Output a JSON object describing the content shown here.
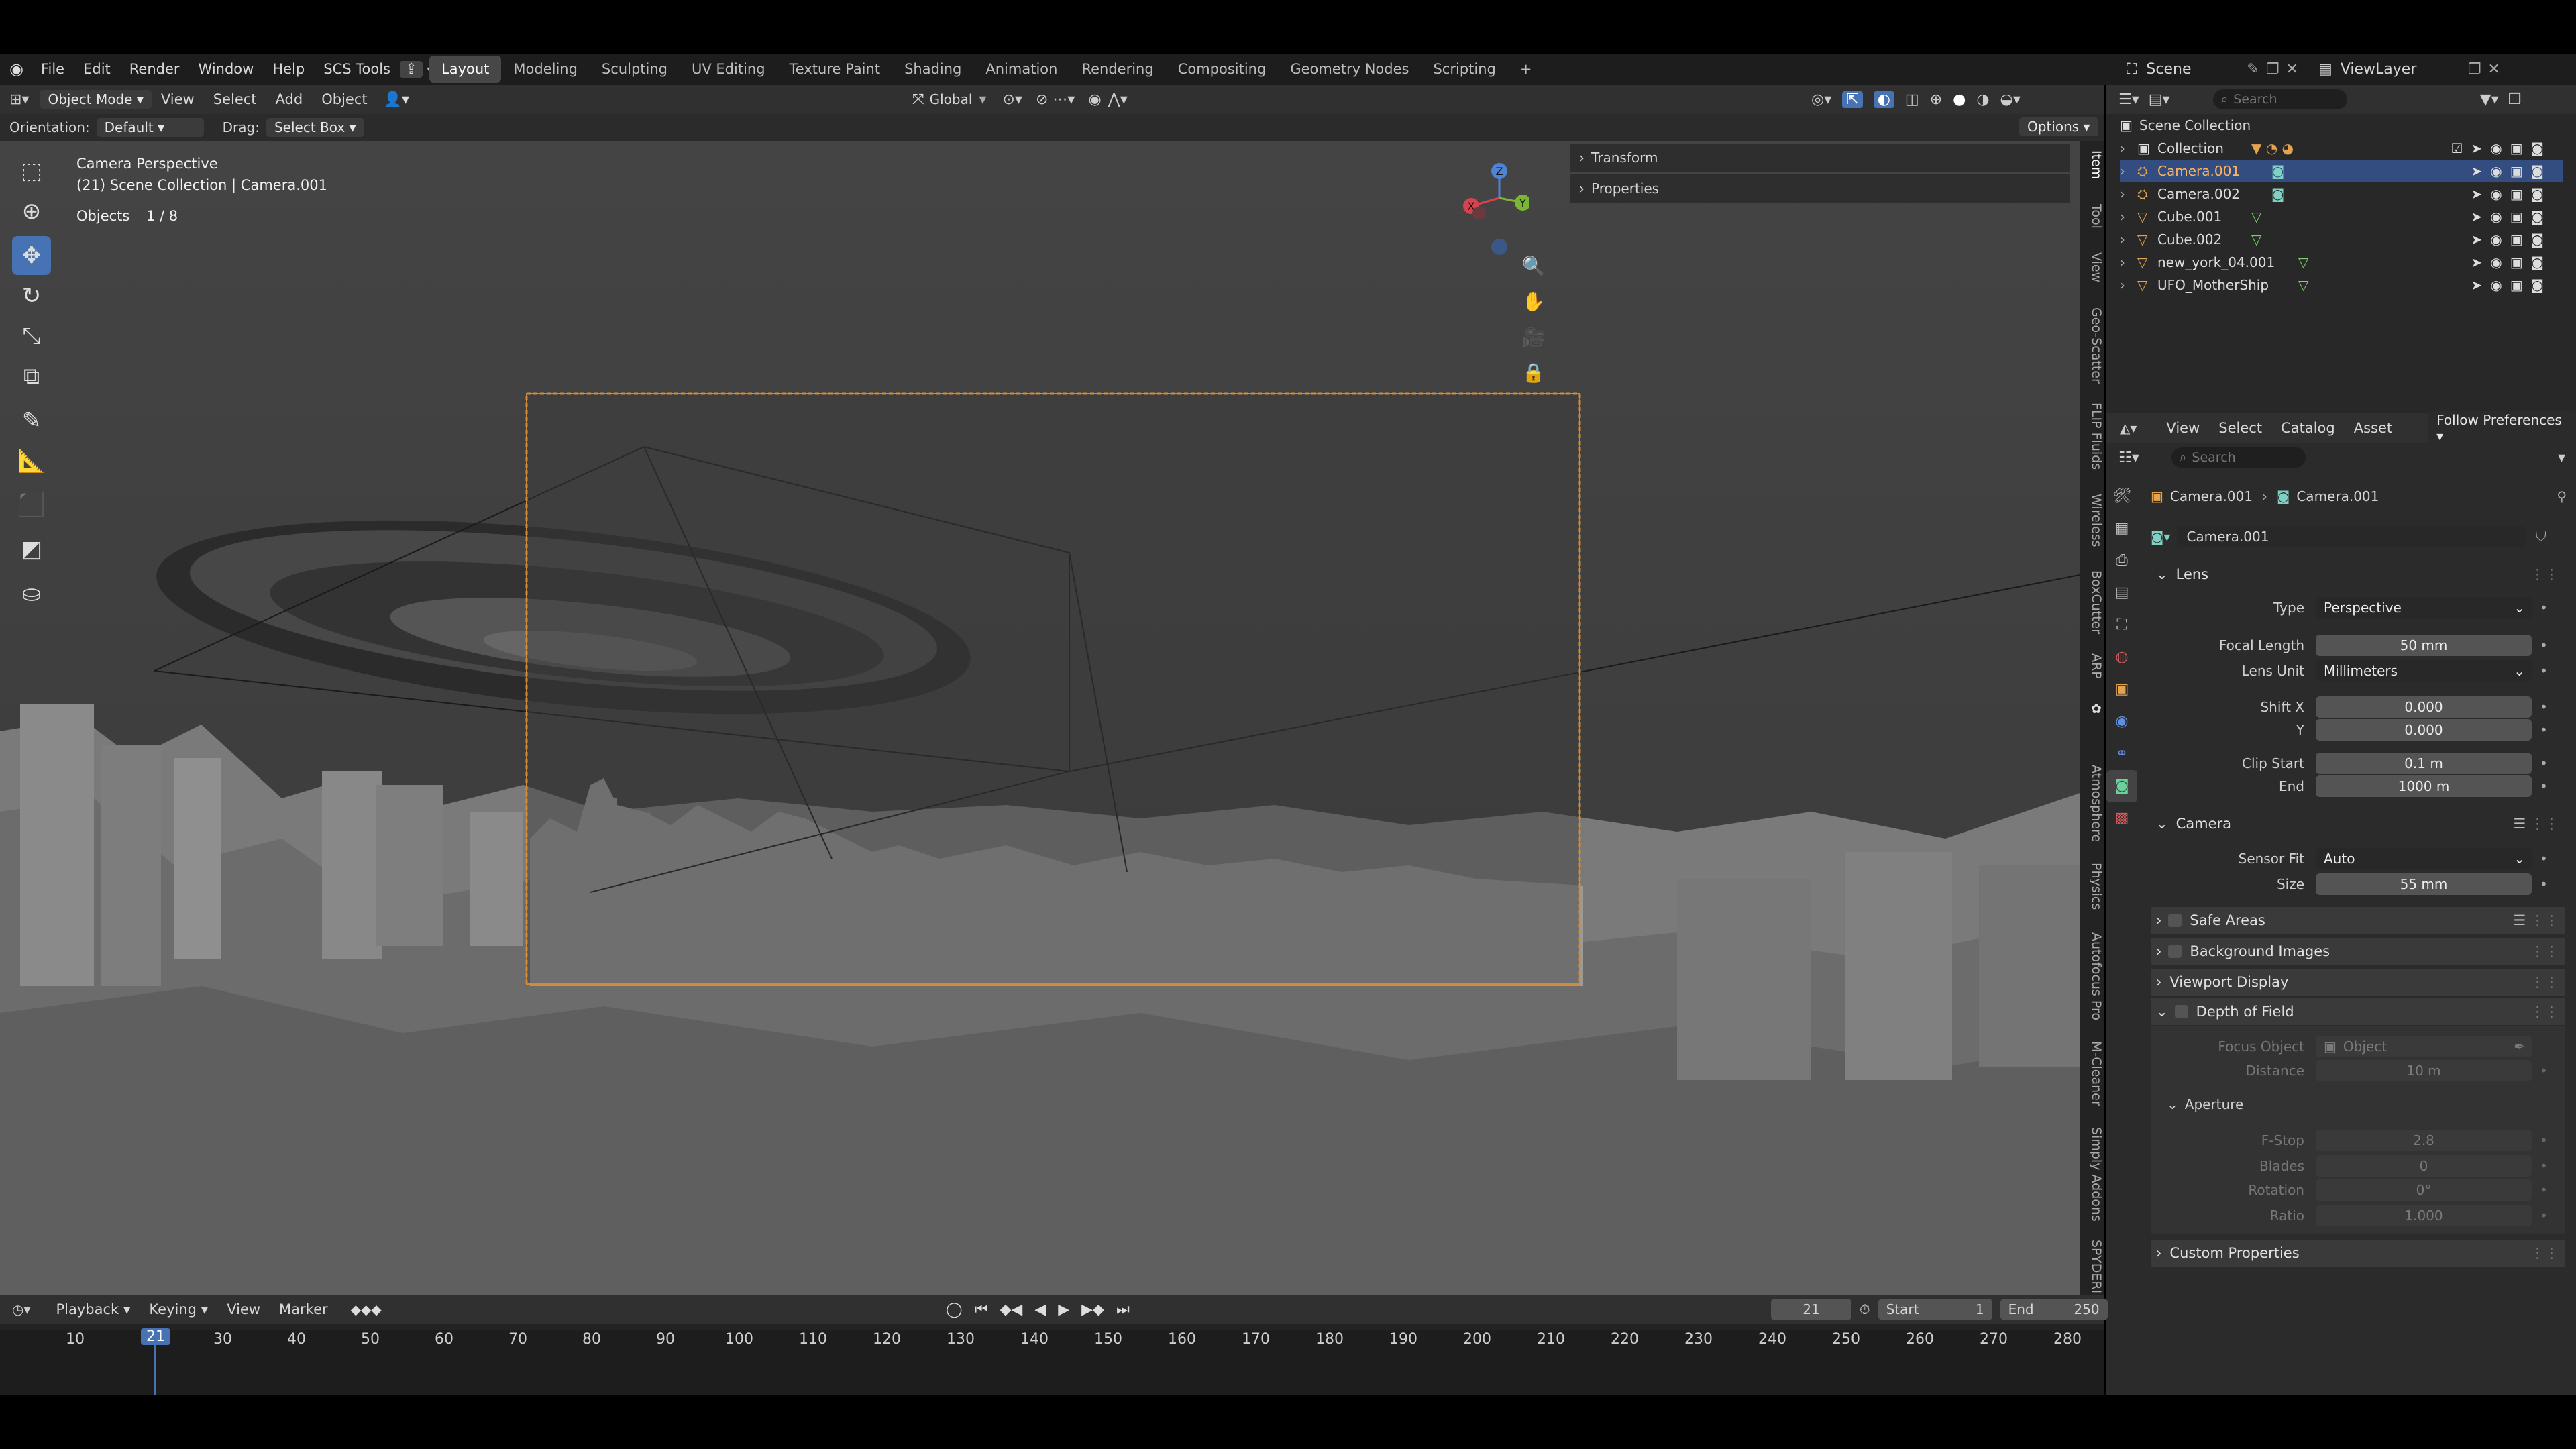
{
  "topbar": {
    "menus": [
      "File",
      "Edit",
      "Render",
      "Window",
      "Help",
      "SCS Tools"
    ],
    "workspaces": [
      "Layout",
      "Modeling",
      "Sculpting",
      "UV Editing",
      "Texture Paint",
      "Shading",
      "Animation",
      "Rendering",
      "Compositing",
      "Geometry Nodes",
      "Scripting"
    ],
    "active_workspace": "Layout",
    "scene": "Scene",
    "view_layer": "ViewLayer"
  },
  "viewport_header": {
    "mode": "Object Mode",
    "menus": [
      "View",
      "Select",
      "Add",
      "Object"
    ],
    "transform": "Global",
    "orientation_label": "Orientation:",
    "orientation_value": "Default",
    "drag_label": "Drag:",
    "drag_value": "Select Box",
    "options": "Options"
  },
  "viewport": {
    "title": "Camera Perspective",
    "subtitle": "(21) Scene Collection | Camera.001",
    "objects_label": "Objects",
    "objects_value": "1 / 8",
    "gizmo_axes": {
      "x": "X",
      "y": "Y",
      "z": "Z"
    }
  },
  "n_panel": {
    "sections": [
      "Transform",
      "Properties"
    ],
    "tabs": [
      "Item",
      "Tool",
      "View",
      "Geo-Scatter",
      "FLIP Fluids",
      "Wireless",
      "BoxCutter",
      "ARP",
      "Atmosphere",
      "Physics",
      "Autofocus Pro",
      "M-Cleaner",
      "Simply Addons",
      "SPYDERI"
    ]
  },
  "outliner": {
    "search_placeholder": "Search",
    "root": "Scene Collection",
    "items": [
      {
        "name": "Collection",
        "type": "collection"
      },
      {
        "name": "Camera.001",
        "type": "camera",
        "selected": true
      },
      {
        "name": "Camera.002",
        "type": "camera"
      },
      {
        "name": "Cube.001",
        "type": "mesh"
      },
      {
        "name": "Cube.002",
        "type": "mesh"
      },
      {
        "name": "new_york_04.001",
        "type": "mesh"
      },
      {
        "name": "UFO_MotherShip",
        "type": "mesh"
      }
    ]
  },
  "properties": {
    "menus": [
      "View",
      "Select",
      "Catalog",
      "Asset"
    ],
    "follow": "Follow Preferences",
    "search_placeholder": "Search",
    "breadcrumb": [
      "Camera.001",
      "Camera.001"
    ],
    "datablock": "Camera.001",
    "lens": {
      "title": "Lens",
      "type_label": "Type",
      "type": "Perspective",
      "focal_label": "Focal Length",
      "focal": "50 mm",
      "unit_label": "Lens Unit",
      "unit": "Millimeters",
      "shiftx_label": "Shift X",
      "shiftx": "0.000",
      "shifty_label": "Y",
      "shifty": "0.000",
      "clipstart_label": "Clip Start",
      "clipstart": "0.1 m",
      "clipend_label": "End",
      "clipend": "1000 m"
    },
    "camera": {
      "title": "Camera",
      "fit_label": "Sensor Fit",
      "fit": "Auto",
      "size_label": "Size",
      "size": "55 mm"
    },
    "collapsed": [
      "Safe Areas",
      "Background Images",
      "Viewport Display"
    ],
    "dof": {
      "title": "Depth of Field",
      "focus_label": "Focus Object",
      "focus_placeholder": "Object",
      "distance_label": "Distance",
      "distance": "10 m",
      "aperture": "Aperture",
      "fstop_label": "F-Stop",
      "fstop": "2.8",
      "blades_label": "Blades",
      "blades": "0",
      "rotation_label": "Rotation",
      "rotation": "0°",
      "ratio_label": "Ratio",
      "ratio": "1.000"
    },
    "custom": "Custom Properties"
  },
  "timeline": {
    "menus": [
      "Playback",
      "Keying",
      "View",
      "Marker"
    ],
    "current_frame": "21",
    "start_label": "Start",
    "start": "1",
    "end_label": "End",
    "end": "250",
    "ticks": [
      "10",
      "30",
      "40",
      "50",
      "60",
      "70",
      "80",
      "90",
      "100",
      "110",
      "120",
      "130",
      "140",
      "150",
      "160",
      "170",
      "180",
      "190",
      "200",
      "210",
      "220",
      "230",
      "240",
      "250",
      "260",
      "270",
      "280"
    ],
    "current_tick": "21"
  },
  "colors": {
    "accent": "#4772b3",
    "camera_frame": "#d08a3a",
    "selected_row": "#334d80"
  }
}
